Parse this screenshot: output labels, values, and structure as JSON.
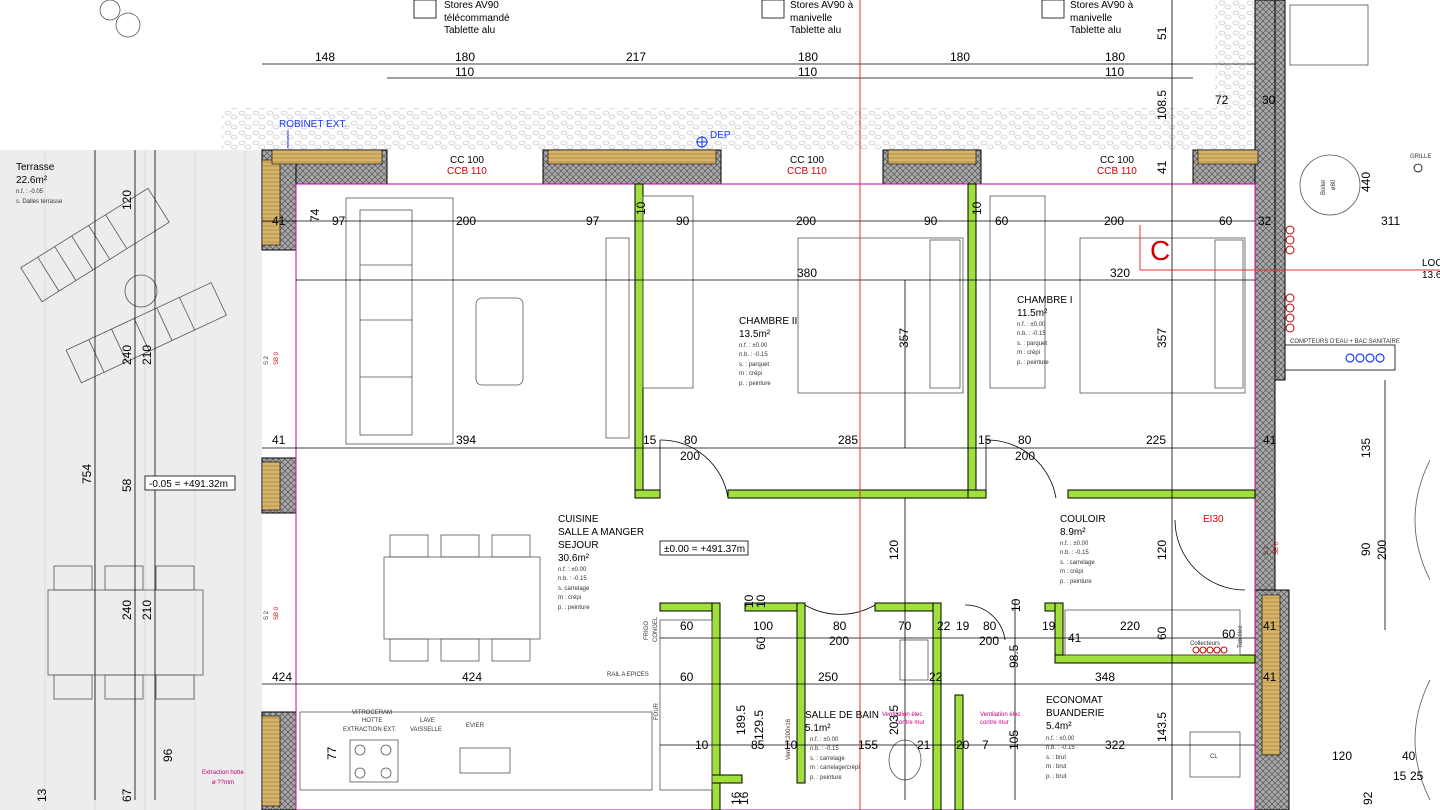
{
  "top_notes": [
    {
      "line1": "Stores AV90",
      "line2": "télécommandé",
      "line3": "Tablette alu"
    },
    {
      "line1": "Stores AV90 à",
      "line2": "manivelle",
      "line3": "Tablette alu"
    },
    {
      "line1": "Stores AV90 à",
      "line2": "manivelle",
      "line3": "Tablette alu"
    }
  ],
  "top_dims_outer": [
    "148",
    "180",
    "217",
    "180",
    "180",
    "180"
  ],
  "top_dims_inner": [
    "110",
    "110",
    "110"
  ],
  "right_dims_top": [
    "51",
    "108.5",
    "72",
    "30",
    "41",
    "440",
    "311"
  ],
  "labels": {
    "robinet": "ROBINET EXT.",
    "dep": "DEP",
    "section_c": "C",
    "ei30": "EI30",
    "boiler": "Boiler",
    "boiler_size": "ø80",
    "grille": "GRILLE",
    "collecteurs": "Collecteurs",
    "tab_elec": "Tab.élec",
    "compteurs": "COMPTEURS D'EAU + BAC SANITAIRE",
    "frigo": "FRIGO",
    "congel": "CONGEL",
    "four": "FOUR",
    "rail": "RAIL A EPICES",
    "vitroceram": "VITROCERAM",
    "hotte": "HOTTE",
    "extraction": "EXTRACTION EXT.",
    "lave": "LAVE",
    "vaisselle": "VAISSELLE",
    "evier": "EVIER",
    "extraction_hotte": "Extraction hotte",
    "extraction_hotte2": "ø ??mm",
    "ventil1": "Ventilation élec",
    "ventil1b": "contre mur",
    "ventil2": "Ventilation élec",
    "ventil2b": "contre mur",
    "cl": "CL",
    "s2": "S 2",
    "sb0": "SB 0",
    "vent_h": "Vent. H:200x16"
  },
  "window_labels": [
    {
      "cc": "CC 100",
      "ccb": "CCB 110"
    },
    {
      "cc": "CC 100",
      "ccb": "CCB 110"
    },
    {
      "cc": "CC 100",
      "ccb": "CCB 110"
    }
  ],
  "levels": {
    "terrace": "-0.05 = +491.32m",
    "interior": "±0.00 = +491.37m"
  },
  "rooms": {
    "terrasse": {
      "name": "Terrasse",
      "area": "22.6m²",
      "nf": "n.f. : -0.05",
      "s": "s. Dalles terrasse"
    },
    "chambre2": {
      "name": "CHAMBRE II",
      "area": "13.5m²",
      "nf": "n.f. : ±0.00",
      "nb": "n.b. : -0.15",
      "s": "s. : parquet",
      "m": "m : crépi",
      "p": "p. : peinture"
    },
    "chambre1": {
      "name": "CHAMBRE I",
      "area": "11.5m²",
      "nf": "n.f. : ±0.00",
      "nb": "n.b. : -0.15",
      "s": "s. : parquet",
      "m": "m : crépi",
      "p": "p. : peinture"
    },
    "sejour": {
      "name1": "CUISINE",
      "name2": "SALLE A MANGER",
      "name3": "SEJOUR",
      "area": "30.6m²",
      "nf": "n.f. : ±0.00",
      "nb": "n.b. : -0.15",
      "s": "s. carrelage",
      "m": "m : crépi",
      "p": "p. : peinture"
    },
    "couloir": {
      "name": "COULOIR",
      "area": "8.9m²",
      "nf": "n.f. : ±0.00",
      "nb": "n.b. : -0.15",
      "s": "s. : carrelage",
      "m": "m : crépi",
      "p": "p. : peinture"
    },
    "bain": {
      "name": "SALLE DE BAIN",
      "area": "5.1m²",
      "nf": "n.f. : ±0.00",
      "nb": "n.b. : -0.15",
      "s": "s. : carrelage",
      "m": "m : carrelage/crépi",
      "p": "p. : peinture"
    },
    "economat": {
      "name1": "ECONOMAT",
      "name2": "BUANDERIE",
      "area": "5.4m²",
      "nf": "n.f. : ±0.00",
      "nb": "n.b. : -0.15",
      "s": "s. : brut",
      "m": "m : brut",
      "p": "p. : brut"
    },
    "local": {
      "name": "LOC",
      "area": "13.6"
    }
  },
  "dims": {
    "d41a": "41",
    "d74": "74",
    "d97a": "97",
    "d200a": "200",
    "d97b": "97",
    "d90a": "90",
    "d200b": "200",
    "d90b": "90",
    "d60a": "60",
    "d200c": "200",
    "d60b": "60",
    "d32": "32",
    "d380": "380",
    "d320": "320",
    "d357a": "357",
    "d357b": "357",
    "d41b": "41",
    "d394": "394",
    "d15a": "15",
    "d80a": "80",
    "d200d": "200",
    "d285": "285",
    "d15b": "15",
    "d80b": "80",
    "d200e": "200",
    "d225": "225",
    "d41c": "41",
    "d120l": "120",
    "d240l": "240",
    "d210l": "210",
    "d754": "754",
    "d58": "58",
    "d240m": "240",
    "d210m": "210",
    "d96": "96",
    "d13": "13",
    "d67": "67",
    "d120a": "120",
    "d120b": "120",
    "d135": "135",
    "d90c": "90",
    "d200f": "200",
    "d60c": "60",
    "d100": "100",
    "d10a": "10",
    "d10b": "10",
    "d60d": "60",
    "d80c": "80",
    "d200g": "200",
    "d70": "70",
    "d22a": "22",
    "d19a": "19",
    "d80d": "80",
    "d200h": "200",
    "d19b": "19",
    "d220": "220",
    "d60e": "60",
    "d41d": "41",
    "d10c": "10",
    "d98": "98.5",
    "d41e": "41",
    "d424": "424",
    "d60f": "60",
    "d250": "250",
    "d22b": "22",
    "d348": "348",
    "d41f": "41",
    "d189": "189.5",
    "d129": "129.5",
    "d203": "203.5",
    "d105": "105",
    "d143": "143.5",
    "d10d": "10",
    "d85": "85",
    "d10e": "10",
    "d155": "155",
    "d21": "21",
    "d20": "20",
    "d7": "7",
    "d322": "322",
    "d77": "77",
    "d120c": "120",
    "d40": "40",
    "d15": "15",
    "d25": "25",
    "d92": "92",
    "d16a": "16",
    "d16b": "16",
    "d10f": "10",
    "d10g": "10",
    "d60g": "60"
  }
}
